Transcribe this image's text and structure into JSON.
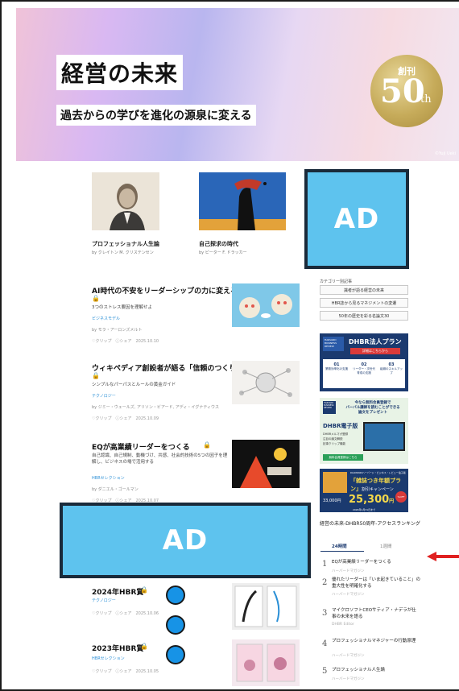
{
  "hero": {
    "title": "経営の未来",
    "subtitle": "過去からの学びを進化の源泉に変える",
    "badge_top": "創刊",
    "badge_num": "50",
    "badge_suffix": "th",
    "credit": "©Yuji Ueki"
  },
  "features": [
    {
      "title": "プロフェッショナル人生論",
      "by": "by クレイトン M. クリステンセン"
    },
    {
      "title": "自己探求の時代",
      "by": "by ピーター F. ドラッカー"
    }
  ],
  "ad_label": "AD",
  "articles": [
    {
      "title": "AI時代の不安をリーダーシップの力に変える",
      "lock": "🔒",
      "sub": "3つのストレス要因を理解せよ",
      "category": "ビジネスモデル",
      "author": "by モラ・アーロンズメルト",
      "actions": "♡クリップ　ⓘシェア　2025.10.10"
    },
    {
      "title": "ウィキペディア創設者が語る「信頼のつくり方」",
      "lock": "🔒",
      "sub": "シンプルなパーパスとルールの黄金ガイド",
      "category": "テクノロジー",
      "author": "by ジミー・ウェールズ, アリソン・ビアード, アディ・イグナティウス",
      "actions": "♡クリップ　ⓘシェア　2025.10.09"
    },
    {
      "title": "EQが高業績リーダーをつくる",
      "lock": "🔒",
      "sub": "自己認識、自己規制、動機づけ、共感、社会的技術の5つの因子を理解し、ビジネスの場で活用する",
      "category": "HBRセレクション",
      "author": "by ダニエル・ゴールマン",
      "actions": "♡クリップ　ⓘシェア　2025.10.07"
    },
    {
      "title": "2024年HBR賞",
      "lock": "🔒",
      "sub": "",
      "category": "テクノロジー",
      "author": "",
      "actions": "♡クリップ　ⓘシェア　2025.10.06"
    },
    {
      "title": "2023年HBR賞",
      "lock": "🔒",
      "sub": "",
      "category": "HBRセレクション",
      "author": "",
      "actions": "♡クリップ　ⓘシェア　2025.10.05"
    }
  ],
  "sidebar": {
    "category_label": "カテゴリー別記事",
    "buttons": [
      "識者が語る経営の未来",
      "HBR誌から見るマネジメントの変遷",
      "50年の歴史を彩る名論文30"
    ],
    "plan": {
      "brand": "HARVARD BUSINESS REVIEW",
      "title": "DHBR法人プラン",
      "cta": "詳細はこちらから",
      "c1": "業務効率化の支援",
      "c2": "リーダー・次世代育成の支援",
      "c3": "組織のスキルアップ"
    },
    "ebook": {
      "brand": "HARVARD BUSINESS REVIEW",
      "headline": "今なら無料会員登録で\nバーバル講師を読むことができる\n論文をプレゼント",
      "title": "DHBR電子版",
      "b1": "DHBRメルマガ登録",
      "b2": "注目の論文解説",
      "b3": "記事クリップ機能",
      "cta": "無料会員登録はこちら"
    },
    "campaign": {
      "top": "DIAMONDハーバード・ビジネス・レビュー電子版",
      "title": "「雑誌つき年額プラン」",
      "subtitle": "割引キャンペーン",
      "old": "33,000円",
      "price": "25,300",
      "unit": "円",
      "discount": "%OFF",
      "note": "2026年1月31日まで"
    },
    "ranking": {
      "heading": "経営の未来-DHBR50周年-アクセスランキング",
      "tabs": [
        "24時間",
        "1週間"
      ],
      "items": [
        {
          "num": "1",
          "title": "EQが高業績リーダーをつくる",
          "src": "ハーバードマガジン"
        },
        {
          "num": "2",
          "title": "優れたリーダーは「いま起きていること」の重大性を明確化する",
          "src": "ハーバードマガジン"
        },
        {
          "num": "3",
          "title": "マイクロソフトCEOサティア・ナデラが仕事の未来を語る",
          "src": "DHBR Editor"
        },
        {
          "num": "4",
          "title": "プロフェッショナルマネジャーの行動原理",
          "src": "ハーバードマガジン"
        },
        {
          "num": "5",
          "title": "プロフェッショナル人生論",
          "src": "ハーバードマガジン"
        }
      ]
    }
  },
  "colors": {
    "ad": "#5ec3ee",
    "dot": "#1793e6",
    "arrow": "#e02020",
    "link": "#2a8fd6"
  }
}
